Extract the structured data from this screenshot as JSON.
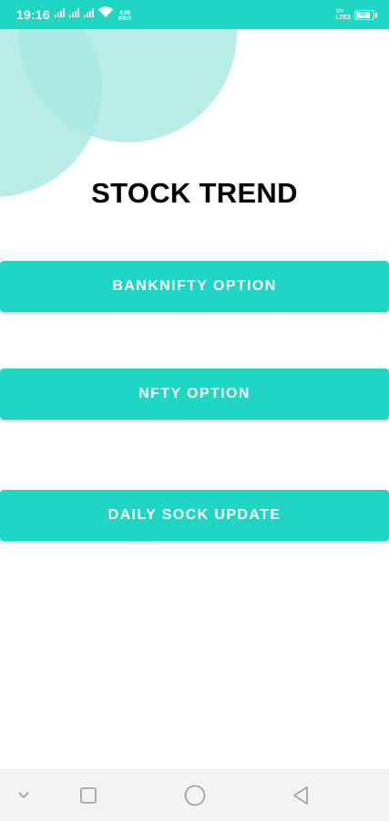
{
  "status_bar": {
    "time": "19:16",
    "network_speed_value": "0.00",
    "network_speed_unit": "KB/S",
    "volte_top": "Vo",
    "volte_bottom": "LTE2",
    "battery_percent": "88",
    "icons": [
      "signal-icon",
      "signal-icon",
      "signal-icon",
      "wifi-icon",
      "battery-icon"
    ]
  },
  "app": {
    "title": "STOCK TREND"
  },
  "buttons": {
    "banknifty": "BANKNIFTY OPTION",
    "nifty": "NFTY OPTION",
    "daily": "DAILY SOCK UPDATE"
  },
  "nav": {
    "icons": [
      "chevron-down-icon",
      "square-icon",
      "circle-icon",
      "triangle-back-icon"
    ]
  },
  "colors": {
    "accent": "#1ed6c3",
    "decor": "#a6e9e1",
    "nav_background": "#f3f3f3"
  }
}
